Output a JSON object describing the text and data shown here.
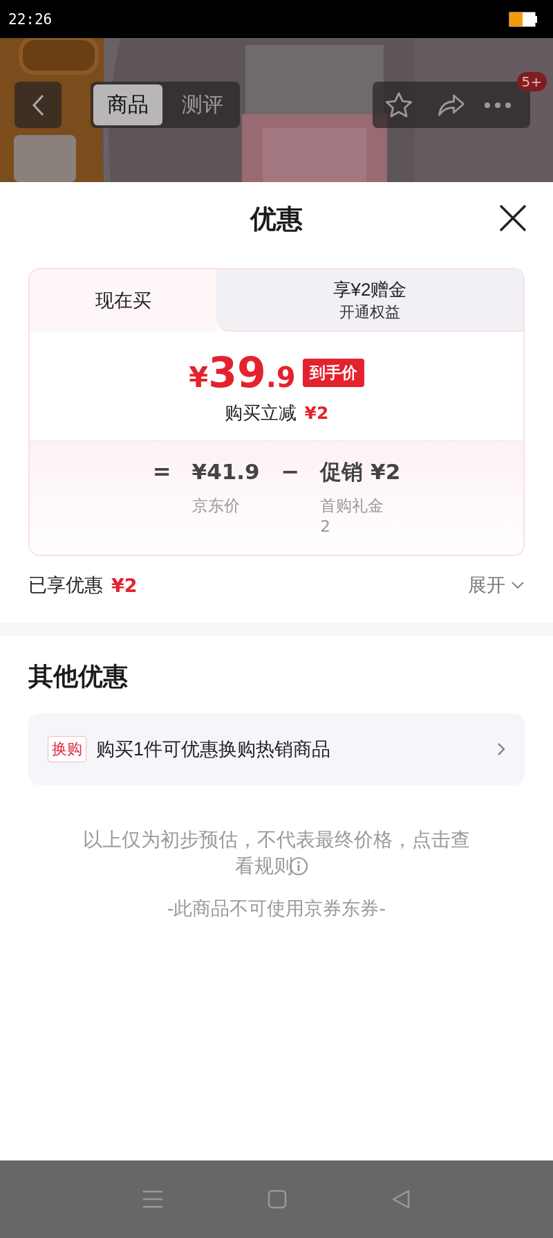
{
  "status_bar": {
    "time": "22:26"
  },
  "header": {
    "tabs": [
      {
        "label": "商品",
        "selected": true
      },
      {
        "label": "测评",
        "selected": false
      }
    ],
    "badge": "5+"
  },
  "sheet": {
    "title": "优惠",
    "tabs": [
      {
        "label": "现在买",
        "selected": true
      },
      {
        "label": "享¥2赠金",
        "sub": "开通权益",
        "selected": false
      }
    ],
    "price": {
      "symbol": "¥",
      "integer": "39",
      "decimal": ".9",
      "tag": "到手价",
      "saving_label": "购买立减",
      "saving_value": "¥2"
    },
    "breakdown": [
      {
        "kind": "operator",
        "symbol": "="
      },
      {
        "kind": "term",
        "value": "¥41.9",
        "label": "京东价"
      },
      {
        "kind": "operator",
        "symbol": "−"
      },
      {
        "kind": "term",
        "value": "促销 ¥2",
        "label": "首购礼金2"
      }
    ],
    "enjoyed": {
      "label": "已享优惠",
      "value": "¥2",
      "toggle": "展开",
      "expanded": false
    }
  },
  "other": {
    "title": "其他优惠",
    "items": [
      {
        "tag": "换购",
        "text": "购买1件可优惠换购热销商品"
      }
    ],
    "note": "以上仅为初步预估，不代表最终价格，点击查看规则",
    "footnote": "-此商品不可使用京券东券-"
  }
}
